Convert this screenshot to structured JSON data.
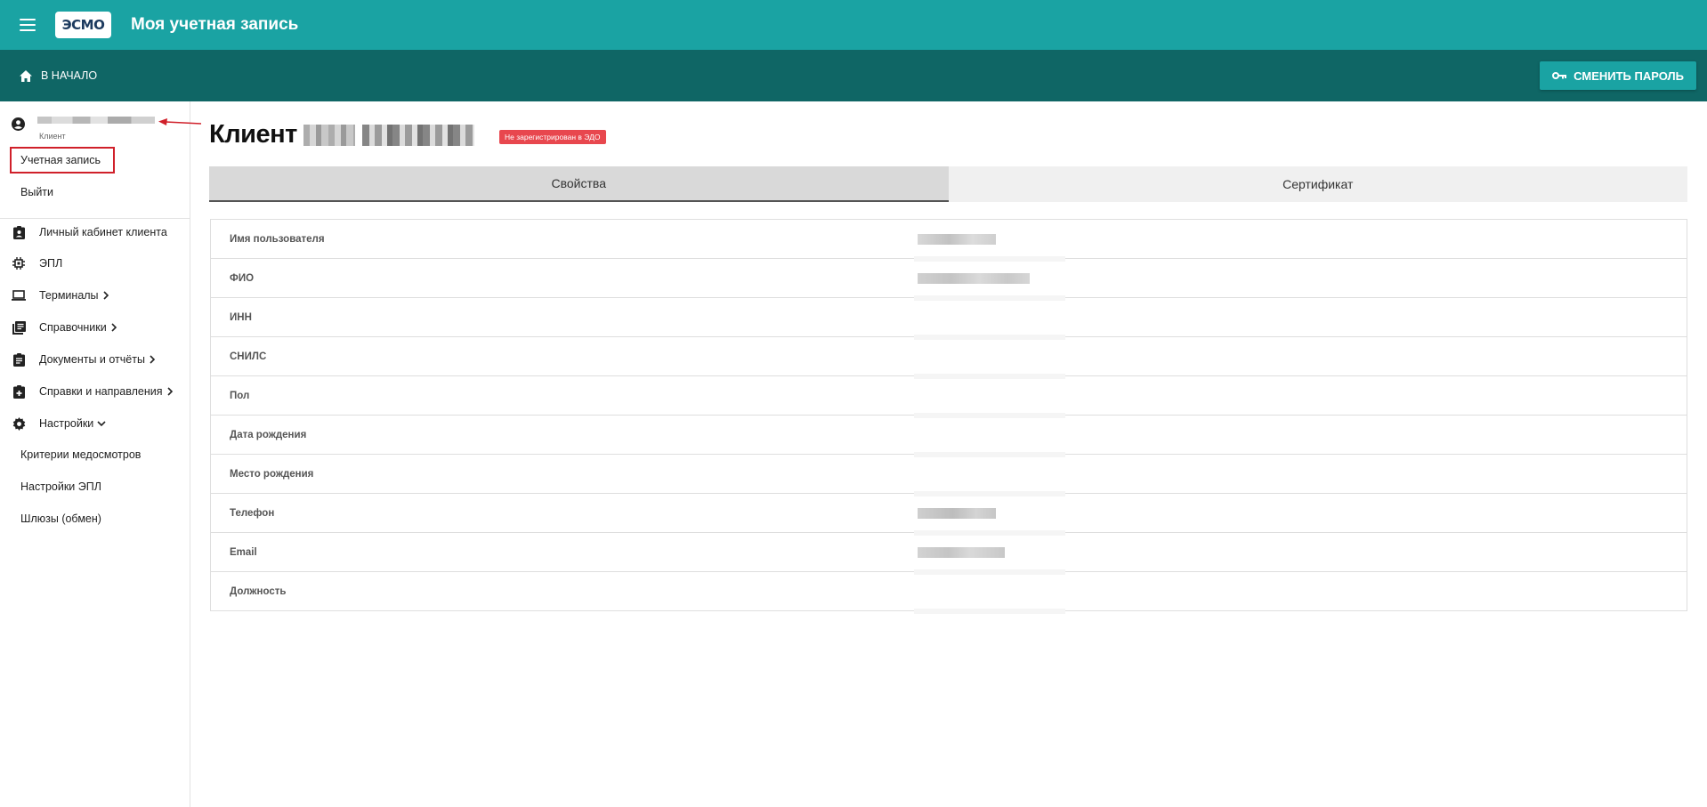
{
  "app": {
    "title": "Моя учетная запись",
    "logo_text": "ЭСМО",
    "brand_color": "#1aa3a3",
    "subbar_color": "#0f6665"
  },
  "toolbar": {
    "home_label": "В НАЧАЛО",
    "change_password_label": "СМЕНИТЬ ПАРОЛЬ"
  },
  "sidebar": {
    "user_role": "Клиент",
    "account_label": "Учетная запись",
    "logout_label": "Выйти",
    "items": [
      {
        "label": "Личный кабинет клиента",
        "icon": "client-card-icon"
      },
      {
        "label": "ЭПЛ",
        "icon": "chip-icon"
      },
      {
        "label": "Терминалы",
        "icon": "laptop-icon"
      },
      {
        "label": "Справочники",
        "icon": "library-icon"
      },
      {
        "label": "Документы и отчёты",
        "icon": "clipboard-icon"
      },
      {
        "label": "Справки и направления",
        "icon": "medical-clipboard-icon"
      },
      {
        "label": "Настройки",
        "icon": "gear-icon"
      }
    ],
    "settings_sub": [
      "Критерии медосмотров",
      "Настройки ЭПЛ",
      "Шлюзы (обмен)"
    ]
  },
  "main": {
    "client_label": "Клиент",
    "badge": "Не зарегистрирован в ЭДО",
    "badge_color": "#e8474e",
    "tabs": [
      "Свойства",
      "Сертификат"
    ],
    "properties": [
      "Имя пользователя",
      "ФИО",
      "ИНН",
      "СНИЛС",
      "Пол",
      "Дата рождения",
      "Место рождения",
      "Телефон",
      "Email",
      "Должность"
    ]
  }
}
